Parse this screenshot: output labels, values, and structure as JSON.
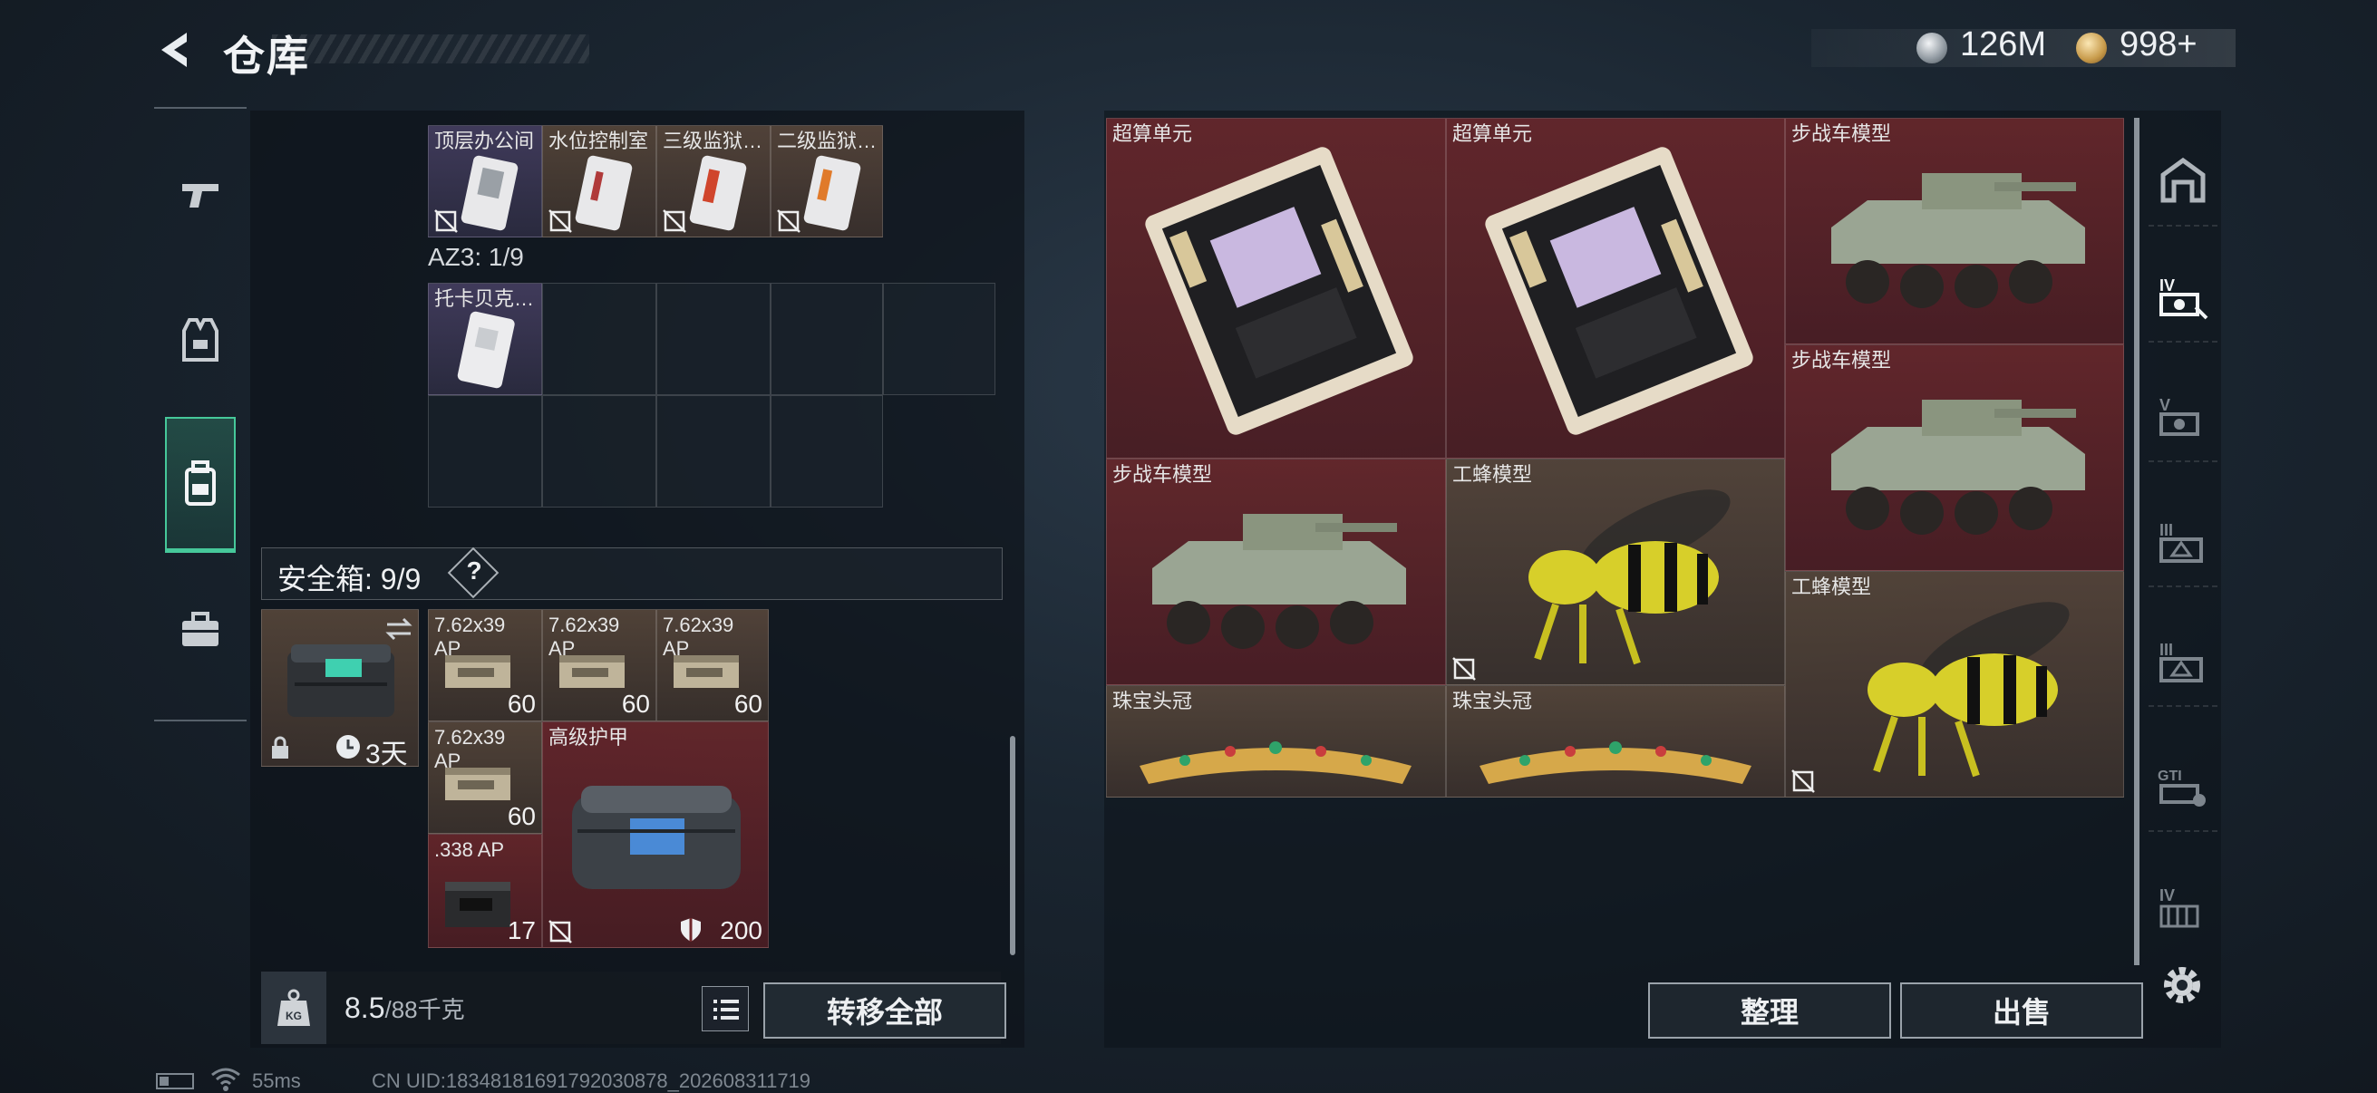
{
  "header": {
    "title": "仓库",
    "currency": [
      {
        "icon": "silver-coin-icon",
        "value": "126M"
      },
      {
        "icon": "gold-coin-icon",
        "value": "998+"
      }
    ]
  },
  "left_nav": {
    "items": [
      {
        "id": "weapons",
        "icon": "gun-icon"
      },
      {
        "id": "equipment",
        "icon": "vest-icon"
      },
      {
        "id": "backpack",
        "icon": "backpack-icon",
        "active": true
      },
      {
        "id": "toolbox",
        "icon": "briefcase-icon"
      }
    ]
  },
  "storage": {
    "top_items": [
      "顶层办公间",
      "水位控制室",
      "三级监狱…",
      "二级监狱…"
    ],
    "az3_label": "AZ3: 1/9",
    "az3_items": [
      "托卡贝克…"
    ],
    "safebox_label": "安全箱: 9/9",
    "help": "?",
    "safebox_timer": "3天",
    "safebox_items": [
      {
        "label": "7.62x39 AP",
        "count": "60"
      },
      {
        "label": "7.62x39 AP",
        "count": "60"
      },
      {
        "label": "7.62x39 AP",
        "count": "60"
      },
      {
        "label": "7.62x39 AP",
        "count": "60"
      },
      {
        "label": "高级护甲",
        "count": "200"
      },
      {
        "label": ".338 AP",
        "count": "17"
      }
    ],
    "weight": "8.5",
    "weight_max": "/88千克",
    "transfer_all": "转移全部"
  },
  "stash": {
    "items": [
      {
        "label": "超算单元"
      },
      {
        "label": "超算单元"
      },
      {
        "label": "步战车模型"
      },
      {
        "label": "步战车模型"
      },
      {
        "label": "步战车模型"
      },
      {
        "label": "工蜂模型"
      },
      {
        "label": "工蜂模型"
      },
      {
        "label": "珠宝头冠"
      },
      {
        "label": "珠宝头冠"
      }
    ],
    "sort_label": "整理",
    "sell_label": "出售"
  },
  "right_rail": {
    "items": [
      "home-icon",
      "IV",
      "V",
      "III",
      "III",
      "GTI",
      "IV"
    ]
  },
  "status": {
    "ping": "55ms",
    "uid": "CN UID:18348181691792030878_202608311719"
  },
  "colors": {
    "accent": "#46c89a",
    "red_rarity": "#6e282c",
    "brown_rarity": "#604c3e",
    "purple_rarity": "#504670"
  }
}
